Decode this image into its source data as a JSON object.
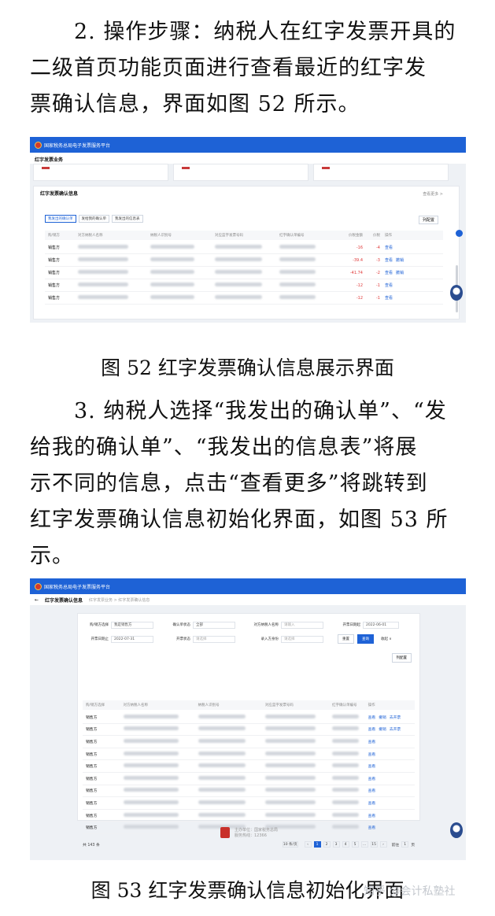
{
  "para1": {
    "line1": "2. 操作步骤：纳税人在红字发票开具的",
    "line2": "二级首页功能页面进行查看最近的红字发",
    "line3": "票确认信息，界面如图 52 所示。"
  },
  "caption52": "图  52 红字发票确认信息展示界面",
  "para2": {
    "line1": "3. 纳税人选择“我发出的确认单”、“发",
    "line2": "给我的确认单”、“我发出的信息表”将展",
    "line3": "示不同的信息，点击“查看更多”将跳转到",
    "line4": "红字发票确认信息初始化界面，如图 53 所",
    "line5": "示。"
  },
  "caption53": "图  53 红字发票确认信息初始化界面",
  "watermark": "知乎 @会计私塾社",
  "shot1": {
    "site_title": "国家税务总局电子发票服务平台",
    "page_title": "红字发票业务",
    "panel_title": "红字发票确认信息",
    "more_link": "查看更多 >",
    "tabs": [
      "我发出的确认单",
      "发给我的确认单",
      "我发出的信息表"
    ],
    "list_button": "列配置",
    "columns": [
      "购/销方",
      "对方纳税人名称",
      "纳税人识别号",
      "对应蓝字发票号码",
      "红字确认单编号",
      "价税金额",
      "价税",
      "操作"
    ],
    "rows": [
      {
        "party": "销售方",
        "amount": "-16",
        "tax": "-4",
        "ops": [
          "查看"
        ]
      },
      {
        "party": "销售方",
        "amount": "-39.4",
        "tax": "-3",
        "ops": [
          "查看",
          "撤销"
        ]
      },
      {
        "party": "销售方",
        "amount": "-41.74",
        "tax": "-2",
        "ops": [
          "查看",
          "撤销"
        ]
      },
      {
        "party": "销售方",
        "amount": "-12",
        "tax": "-1",
        "ops": [
          "查看"
        ]
      },
      {
        "party": "销售方",
        "amount": "-12",
        "tax": "-1",
        "ops": [
          "查看"
        ]
      }
    ]
  },
  "shot2": {
    "site_title": "国家税务总局电子发票服务平台",
    "page_title": "红字发票确认信息",
    "breadcrumb": "红字发票业务 > 红字发票确认信息",
    "filters": {
      "party_label": "购/销方选择",
      "party_value": "我是销售方",
      "status_label": "确认单状态",
      "status_value": "全部",
      "name_label": "对方纳税人名称",
      "name_placeholder": "请输入",
      "start_label": "开票日期起",
      "start_value": "2022-06-01",
      "end_label": "开票日期止",
      "end_value": "2022-07-31",
      "invstatus_label": "开票状态",
      "invstatus_placeholder": "请选择",
      "entry_label": "录入方身份",
      "entry_placeholder": "请选择"
    },
    "buttons": {
      "reset": "重置",
      "search": "查询",
      "collapse": "收起 ∨",
      "list": "列配置"
    },
    "columns": [
      "购/销方选择",
      "对方纳税人名称",
      "纳税人识别号",
      "对应蓝字发票号码",
      "红字确认单编号",
      "操作"
    ],
    "rows": [
      {
        "party": "销售方",
        "ops": [
          "查看",
          "撤销",
          "去开票"
        ]
      },
      {
        "party": "销售方",
        "ops": [
          "查看",
          "撤销",
          "去开票"
        ]
      },
      {
        "party": "销售方",
        "ops": [
          "查看"
        ]
      },
      {
        "party": "销售方",
        "ops": [
          "查看"
        ]
      },
      {
        "party": "销售方",
        "ops": [
          "查看"
        ]
      },
      {
        "party": "销售方",
        "ops": [
          "查看"
        ]
      },
      {
        "party": "销售方",
        "ops": [
          "查看"
        ]
      },
      {
        "party": "销售方",
        "ops": [
          "查看"
        ]
      },
      {
        "party": "销售方",
        "ops": [
          "查看"
        ]
      },
      {
        "party": "销售方",
        "ops": [
          "查看"
        ]
      }
    ],
    "pager": {
      "total": "共 143 条",
      "page_size": "10 条/页",
      "pages": [
        "1",
        "2",
        "3",
        "4",
        "5",
        "...",
        "15"
      ],
      "goto_label": "前往",
      "goto_value": "1",
      "page_unit": "页"
    },
    "footer": {
      "line1": "主办单位：国家税务总局",
      "line2": "服务热线：12366"
    }
  },
  "colors": {
    "brand_blue": "#1e62d6",
    "negative_red": "#e03a3a"
  }
}
